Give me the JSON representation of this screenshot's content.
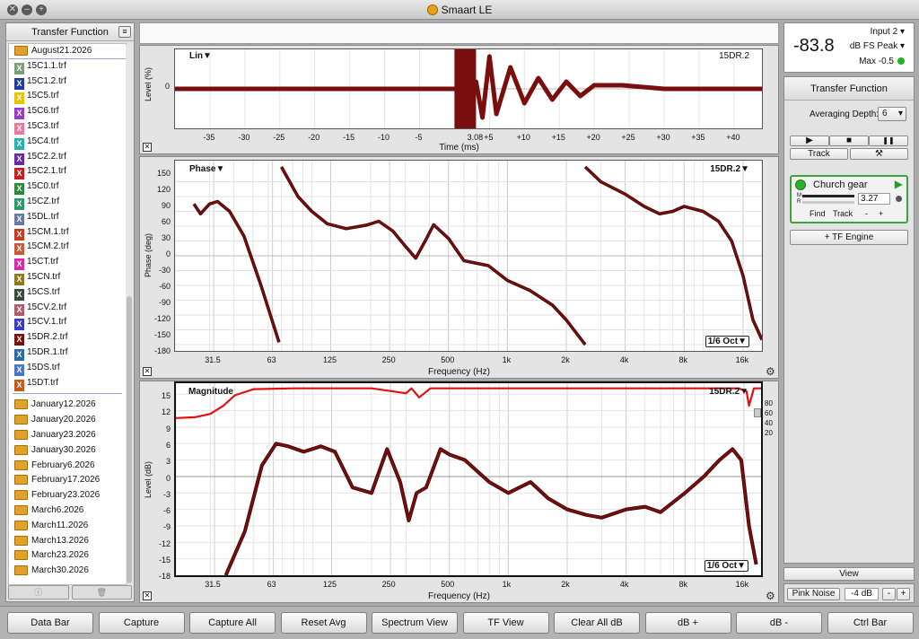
{
  "app": {
    "title": "Smaart LE"
  },
  "tf_panel": {
    "title": "Transfer Function",
    "menu_icon": "list-icon",
    "current_folder": "August21.2026",
    "files": [
      {
        "name": "15C1.1.trf",
        "color": "#7aa07a"
      },
      {
        "name": "15C1.2.trf",
        "color": "#223a9a"
      },
      {
        "name": "15C5.trf",
        "color": "#e8c400"
      },
      {
        "name": "15C6.trf",
        "color": "#9a3ac8"
      },
      {
        "name": "15C3.trf",
        "color": "#e878a0"
      },
      {
        "name": "15C4.trf",
        "color": "#27b0b0"
      },
      {
        "name": "15C2.2.trf",
        "color": "#6a2aa8"
      },
      {
        "name": "15C2.1.trf",
        "color": "#c81e1e"
      },
      {
        "name": "15C0.trf",
        "color": "#2a8a3a"
      },
      {
        "name": "15CZ.trf",
        "color": "#2a9a6a"
      },
      {
        "name": "15DL.trf",
        "color": "#6a78a8"
      },
      {
        "name": "15CM.1.trf",
        "color": "#c83a1e"
      },
      {
        "name": "15CM.2.trf",
        "color": "#c85a3a"
      },
      {
        "name": "15CT.trf",
        "color": "#d82aa8"
      },
      {
        "name": "15CN.trf",
        "color": "#8a7a1a"
      },
      {
        "name": "15CS.trf",
        "color": "#3a4a3a"
      },
      {
        "name": "15CV.2.trf",
        "color": "#b05a6a"
      },
      {
        "name": "15CV.1.trf",
        "color": "#3a3ac8"
      },
      {
        "name": "15DR.2.trf",
        "color": "#7a1010"
      },
      {
        "name": "15DR.1.trf",
        "color": "#2a6aa8"
      },
      {
        "name": "15DS.trf",
        "color": "#4a78c8"
      },
      {
        "name": "15DT.trf",
        "color": "#c85a1a"
      }
    ],
    "folders": [
      "January12.2026",
      "January20.2026",
      "January23.2026",
      "January30.2026",
      "February6.2026",
      "February17.2026",
      "February23.2026",
      "March6.2026",
      "March11.2026",
      "March13.2026",
      "March23.2026",
      "March30.2026"
    ],
    "footer_icons": [
      "info-icon",
      "trash-icon"
    ]
  },
  "time_graph": {
    "label": "Lin▼",
    "trace": "15DR.2",
    "ylabel": "Level (%)",
    "xlabel": "Time (ms)",
    "ytick": "0",
    "xticks": [
      "-35",
      "-30",
      "-25",
      "-20",
      "-15",
      "-10",
      "-5",
      "3.08",
      "+5",
      "+10",
      "+15",
      "+20",
      "+25",
      "+30",
      "+35",
      "+40"
    ]
  },
  "phase_graph": {
    "label": "Phase▼",
    "trace": "15DR.2▼",
    "ylabel": "Phase (deg)",
    "xlabel": "Frequency (Hz)",
    "resolution": "1/6 Oct▼",
    "yticks": [
      "150",
      "120",
      "90",
      "60",
      "30",
      "0",
      "-30",
      "-60",
      "-90",
      "-120",
      "-150",
      "-180"
    ],
    "xticks": [
      "31.5",
      "63",
      "125",
      "250",
      "500",
      "1k",
      "2k",
      "4k",
      "8k",
      "16k"
    ]
  },
  "mag_graph": {
    "label": "Magnitude",
    "trace": "15DR.2▼",
    "ylabel": "Level (dB)",
    "xlabel": "Frequency (Hz)",
    "resolution": "1/6 Oct▼",
    "yticks": [
      "15",
      "12",
      "9",
      "6",
      "3",
      "0",
      "-3",
      "-6",
      "-9",
      "-12",
      "-15",
      "-18"
    ],
    "coh_ticks": [
      "80",
      "60",
      "40",
      "20"
    ],
    "xticks": [
      "31.5",
      "63",
      "125",
      "250",
      "500",
      "1k",
      "2k",
      "4k",
      "8k",
      "16k"
    ]
  },
  "chart_data": [
    {
      "type": "line",
      "title": "",
      "xlabel": "Time (ms)",
      "ylabel": "Level (%)",
      "xlim": [
        -40,
        44
      ],
      "series": [
        {
          "name": "15DR.2",
          "color": "#7a0d0d",
          "x": [
            -40,
            -30,
            -20,
            -10,
            0,
            2,
            3.08,
            4,
            5,
            6,
            8,
            10,
            12,
            14,
            16,
            18,
            20,
            24,
            30,
            36,
            44
          ],
          "y": [
            0,
            0,
            0,
            0,
            0,
            0,
            0.2,
            -0.8,
            0.9,
            -0.7,
            0.6,
            -0.4,
            0.3,
            -0.3,
            0.2,
            -0.2,
            0.1,
            0.1,
            0,
            0,
            0
          ]
        }
      ]
    },
    {
      "type": "line",
      "title": "",
      "xlabel": "Frequency (Hz)",
      "ylabel": "Phase (deg)",
      "xscale": "log",
      "xlim": [
        20,
        20000
      ],
      "ylim": [
        -180,
        180
      ],
      "series": [
        {
          "name": "15DR.2",
          "color": "#7a0d0d",
          "segments": [
            {
              "x": [
                25,
                27,
                30,
                33,
                38,
                45,
                55,
                68
              ],
              "y": [
                105,
                85,
                105,
                110,
                90,
                40,
                -60,
                -175
              ]
            },
            {
              "x": [
                70,
                85,
                100,
                120,
                150,
                190,
                220,
                260,
                300,
                340,
                380,
                420,
                500,
                600,
                800,
                1000,
                1300,
                1700,
                2000,
                2500
              ],
              "y": [
                180,
                120,
                90,
                65,
                55,
                62,
                70,
                50,
                20,
                -5,
                30,
                63,
                35,
                -10,
                -20,
                -50,
                -70,
                -100,
                -130,
                -180
              ]
            },
            {
              "x": [
                2500,
                3000,
                4000,
                5000,
                6000,
                7000,
                8000,
                10000,
                12000,
                14000,
                16000,
                18000,
                20000
              ],
              "y": [
                180,
                150,
                125,
                100,
                85,
                90,
                100,
                90,
                70,
                30,
                -40,
                -130,
                -170
              ]
            }
          ]
        }
      ]
    },
    {
      "type": "line",
      "title": "",
      "xlabel": "Frequency (Hz)",
      "ylabel": "Level (dB)",
      "xscale": "log",
      "xlim": [
        20,
        20000
      ],
      "ylim": [
        -18,
        17
      ],
      "series": [
        {
          "name": "15DR.2",
          "color": "#7a0d0d",
          "x": [
            36,
            45,
            55,
            65,
            75,
            90,
            110,
            130,
            160,
            200,
            240,
            280,
            310,
            340,
            380,
            450,
            500,
            600,
            800,
            1000,
            1300,
            1600,
            2000,
            2500,
            3000,
            4000,
            5000,
            6000,
            8000,
            10000,
            12000,
            14000,
            15500,
            17000,
            18500
          ],
          "y": [
            -18,
            -10,
            2,
            6,
            5.5,
            4.5,
            5.5,
            4.5,
            -2,
            -3,
            5,
            -1,
            -8,
            -3,
            -2,
            5,
            4,
            3,
            -1,
            -3,
            -1,
            -4,
            -6,
            -7,
            -7.5,
            -6,
            -5.5,
            -6.5,
            -3,
            0,
            3,
            5,
            3,
            -9,
            -16
          ]
        },
        {
          "name": "Coherence",
          "color": "#e01010",
          "axis": "right",
          "x": [
            20,
            25,
            30,
            35,
            40,
            50,
            80,
            200,
            300,
            320,
            350,
            400,
            1000,
            5000,
            15000,
            16500,
            17000,
            18000,
            20000
          ],
          "y": [
            20,
            22,
            30,
            50,
            75,
            90,
            92,
            92,
            80,
            92,
            70,
            92,
            92,
            92,
            92,
            85,
            50,
            92,
            92
          ]
        }
      ]
    }
  ],
  "meter": {
    "value": "-83.8",
    "input": "Input 2",
    "scale": "dB FS Peak",
    "max": "Max -0.5"
  },
  "right_panel": {
    "title": "Transfer Function",
    "averaging_label": "Averaging Depth:",
    "averaging_value": "6",
    "play": "▶",
    "stop": "■",
    "pause": "❚❚",
    "track": "Track",
    "tools": "⚒",
    "engine": {
      "name": "Church gear",
      "delay": "3.27",
      "m": "M",
      "r": "R",
      "find": "Find",
      "track": "Track",
      "minus": "-",
      "plus": "+"
    },
    "add_engine": "+ TF Engine",
    "view": "View",
    "pink_noise": "Pink Noise",
    "pink_level": "-4 dB",
    "pink_minus": "-",
    "pink_plus": "+"
  },
  "bottom": [
    "Data Bar",
    "Capture",
    "Capture All",
    "Reset Avg",
    "Spectrum View",
    "TF View",
    "Clear All dB",
    "dB +",
    "dB -",
    "Ctrl Bar"
  ]
}
